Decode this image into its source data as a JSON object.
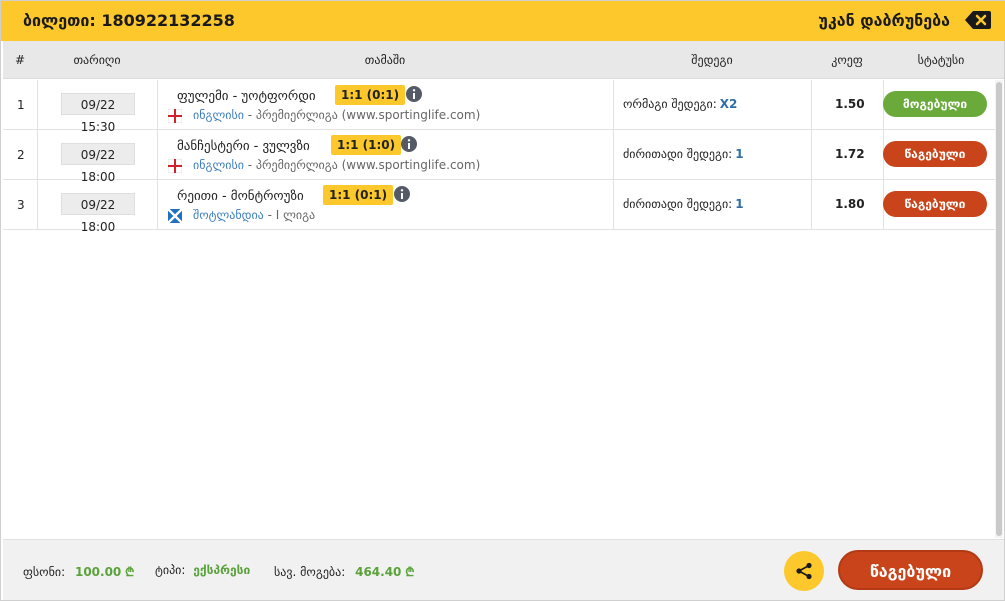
{
  "header": {
    "ticket_label": "ბილეთი: 180922132258",
    "back_label": "უკან დაბრუნება",
    "back_icon": "backspace-icon",
    "bg_color": "#fcc82b"
  },
  "table": {
    "columns": [
      "#",
      "თარიღი",
      "თამაში",
      "შედეგი",
      "კოეფ",
      "სტატუსი"
    ],
    "rows": [
      {
        "num": "1",
        "date": "09/22 15:30",
        "teams": "ფულემი - უოტფორდი",
        "score": "1:1 (0:1)",
        "flag": "england-flag-icon",
        "country": "ინგლისი",
        "league": "- პრემიერლიგა (www.sportinglife.com)",
        "market": "ორმაგი შედეგი:",
        "pick": "X2",
        "odd": "1.50",
        "status": "მოგებული",
        "status_color": "#6aaa3a"
      },
      {
        "num": "2",
        "date": "09/22 18:00",
        "teams": "მანჩესტერი - ვულვზი",
        "score": "1:1 (1:0)",
        "flag": "england-flag-icon",
        "country": "ინგლისი",
        "league": "- პრემიერლიგა (www.sportinglife.com)",
        "market": "ძირითადი შედეგი:",
        "pick": "1",
        "odd": "1.72",
        "status": "წაგებული",
        "status_color": "#c9441a"
      },
      {
        "num": "3",
        "date": "09/22 18:00",
        "teams": "რეითი - მონტროუზი",
        "score": "1:1 (0:1)",
        "flag": "scotland-flag-icon",
        "country": "შოტლანდია",
        "league": "- I ლიგა",
        "market": "ძირითადი შედეგი:",
        "pick": "1",
        "odd": "1.80",
        "status": "წაგებული",
        "status_color": "#c9441a"
      }
    ]
  },
  "footer": {
    "stake_label": "ფსონი:",
    "stake_value": "100.00",
    "currency": "₾",
    "type_label": "ტიპი:",
    "type_value": "ექსპრესი",
    "total_label": "სავ. მოგება:",
    "total_value": "464.40",
    "share_icon": "share-icon",
    "final_status": "წაგებული"
  }
}
